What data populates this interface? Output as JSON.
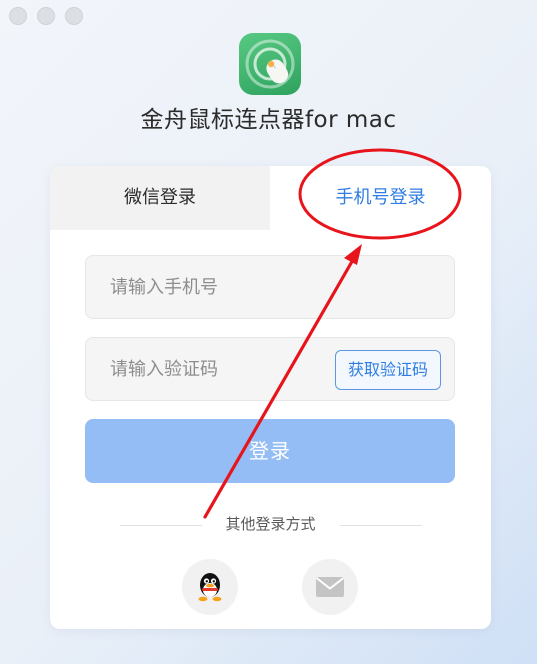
{
  "window": {
    "title": "金舟鼠标连点器for mac"
  },
  "tabs": {
    "wechat_label": "微信登录",
    "phone_label": "手机号登录",
    "active": "phone"
  },
  "form": {
    "phone_placeholder": "请输入手机号",
    "code_placeholder": "请输入验证码",
    "get_code_label": "获取验证码",
    "login_label": "登录"
  },
  "other_login": {
    "label": "其他登录方式",
    "methods": [
      "qq-icon",
      "mail-icon"
    ]
  },
  "colors": {
    "accent": "#2f7de1",
    "login_button": "#95bdf5",
    "annotation": "#e8141b",
    "app_icon": "#3fb86f"
  }
}
